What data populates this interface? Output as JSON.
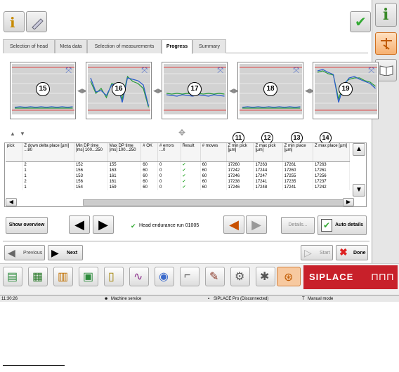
{
  "tabs": [
    {
      "label": "Selection of head"
    },
    {
      "label": "Meta data"
    },
    {
      "label": "Selection of measurements"
    },
    {
      "label": "Progress"
    },
    {
      "label": "Summary"
    }
  ],
  "charts": [
    {
      "num": "15"
    },
    {
      "num": "16"
    },
    {
      "num": "17"
    },
    {
      "num": "18"
    },
    {
      "num": "19"
    }
  ],
  "column_markers": {
    "m11": "11",
    "m12": "12",
    "m13": "13",
    "m14": "14"
  },
  "table": {
    "headers": [
      "pick",
      "Z down delta place [µm] ...80",
      "Min DP time [ms] 100...250",
      "Max DP time [ms] 100...250",
      "# OK",
      "# errors ...0",
      "Result",
      "# moves",
      "Z min pick [µm]",
      "Z max pick [µm]",
      "Z min place [µm]",
      "Z max place [µm]"
    ],
    "rows": [
      [
        "",
        "2",
        "152",
        "155",
        "60",
        "0",
        "✔",
        "60",
        "17260",
        "17263",
        "17261",
        "17263"
      ],
      [
        "",
        "1",
        "156",
        "163",
        "60",
        "0",
        "✔",
        "60",
        "17242",
        "17244",
        "17260",
        "17261"
      ],
      [
        "",
        "1",
        "153",
        "161",
        "60",
        "0",
        "✔",
        "60",
        "17246",
        "17247",
        "17255",
        "17256"
      ],
      [
        "",
        "2",
        "156",
        "161",
        "60",
        "0",
        "✔",
        "60",
        "17238",
        "17241",
        "17235",
        "17237"
      ],
      [
        "",
        "1",
        "154",
        "159",
        "60",
        "0",
        "✔",
        "60",
        "17246",
        "17248",
        "17241",
        "17242"
      ]
    ]
  },
  "controls": {
    "show_overview": "Show overview",
    "head_status": "Head endurance run 01005",
    "details": "Details...",
    "auto_details": "Auto details"
  },
  "nav": {
    "previous": "Previous",
    "next": "Next",
    "start": "Start",
    "done": "Done"
  },
  "brand": "SIPLACE",
  "statusbar": {
    "time": "11:30:26",
    "service": "Machine service",
    "connection": "SIPLACE Pro (Disconnected)",
    "mode": "Manual mode"
  }
}
